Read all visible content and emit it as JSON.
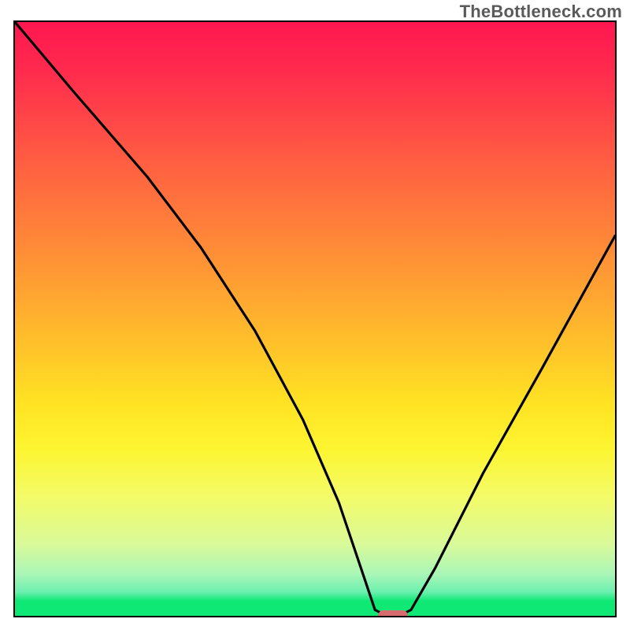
{
  "watermark": "TheBottleneck.com",
  "chart_data": {
    "type": "line",
    "title": "",
    "xlabel": "",
    "ylabel": "",
    "xlim": [
      0,
      100
    ],
    "ylim": [
      0,
      100
    ],
    "grid": false,
    "series": [
      {
        "name": "bottleneck-curve",
        "x": [
          0,
          10,
          22,
          31,
          40,
          48,
          54,
          58,
          60,
          62,
          64,
          66,
          70,
          78,
          88,
          100
        ],
        "y": [
          100,
          88,
          74,
          62,
          48,
          33,
          19,
          7,
          1,
          0,
          0,
          1,
          8,
          24,
          42,
          64
        ]
      }
    ],
    "marker": {
      "x": 63,
      "y": 0,
      "color": "#d86b6d"
    },
    "gradient_stops": [
      {
        "pos": 0,
        "color": "#ff1750"
      },
      {
        "pos": 0.5,
        "color": "#ffb92c"
      },
      {
        "pos": 0.72,
        "color": "#fdf531"
      },
      {
        "pos": 0.93,
        "color": "#a9f6b7"
      },
      {
        "pos": 1.0,
        "color": "#0fe874"
      }
    ]
  },
  "colors": {
    "frame_border": "#000000",
    "curve": "#000000",
    "watermark_text": "#5a5a5a"
  }
}
